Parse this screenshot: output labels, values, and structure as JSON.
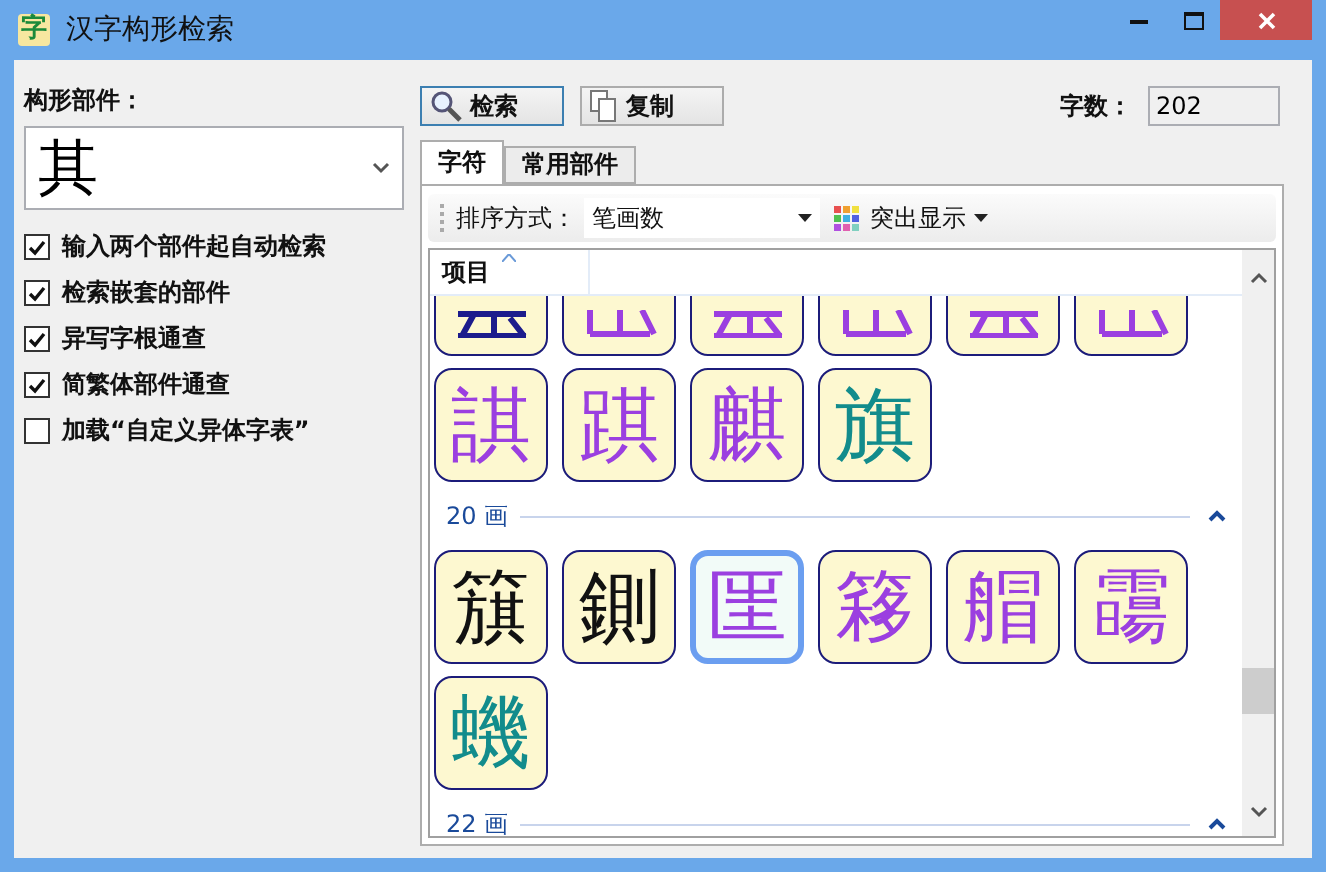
{
  "window": {
    "icon": "字",
    "title": "汉字构形检索"
  },
  "component": {
    "label": "构形部件：",
    "value": "其"
  },
  "options": [
    {
      "label": "输入两个部件起自动检索",
      "checked": true
    },
    {
      "label": "检索嵌套的部件",
      "checked": true
    },
    {
      "label": "异写字根通查",
      "checked": true
    },
    {
      "label": "简繁体部件通查",
      "checked": true
    },
    {
      "label": "加载“自定义异体字表”",
      "checked": false
    }
  ],
  "buttons": [
    {
      "kind": "search",
      "label": "检索"
    },
    {
      "kind": "copy",
      "label": "复制"
    }
  ],
  "count": {
    "label": "字数：",
    "value": "202"
  },
  "tabs": [
    {
      "label": "字符",
      "selected": true
    },
    {
      "label": "常用部件",
      "selected": false
    }
  ],
  "toolbar": {
    "sort_label": "排序方式：",
    "sort_value": "笔画数",
    "highlight": "突出显示"
  },
  "list": {
    "column": "项目",
    "groups": [
      {
        "items": [
          {
            "kind": "cut",
            "color": "#1c1c8c",
            "selected": false
          },
          {
            "kind": "cut",
            "color": "#9b3fe0",
            "selected": false
          },
          {
            "kind": "cut",
            "color": "#9b3fe0",
            "selected": false
          },
          {
            "kind": "cut",
            "color": "#9b3fe0",
            "selected": false
          },
          {
            "kind": "cut",
            "color": "#9b3fe0",
            "selected": false
          },
          {
            "kind": "cut",
            "color": "#9b3fe0",
            "selected": false
          },
          {
            "char": "諆",
            "color": "#9b3fe0",
            "selected": false
          },
          {
            "char": "踑",
            "color": "#9b3fe0",
            "selected": false
          },
          {
            "char": "麒",
            "color": "#9b3fe0",
            "selected": false
          },
          {
            "char": "旗",
            "color": "#128c8c",
            "selected": false
          }
        ]
      },
      {
        "label": "20 画",
        "expanded": true,
        "items": [
          {
            "char": "簱",
            "color": "#111111",
            "selected": false
          },
          {
            "char": "鍘",
            "color": "#111111",
            "selected": false
          },
          {
            "char": "匩",
            "color": "#9b3fe0",
            "selected": true
          },
          {
            "char": "簃",
            "color": "#9b3fe0",
            "selected": false
          },
          {
            "char": "艒",
            "color": "#9b3fe0",
            "selected": false
          },
          {
            "char": "霷",
            "color": "#9b3fe0",
            "selected": false
          },
          {
            "char": "蟣",
            "color": "#128c8c",
            "selected": false
          }
        ]
      },
      {
        "label": "22 画",
        "expanded": true
      }
    ]
  }
}
